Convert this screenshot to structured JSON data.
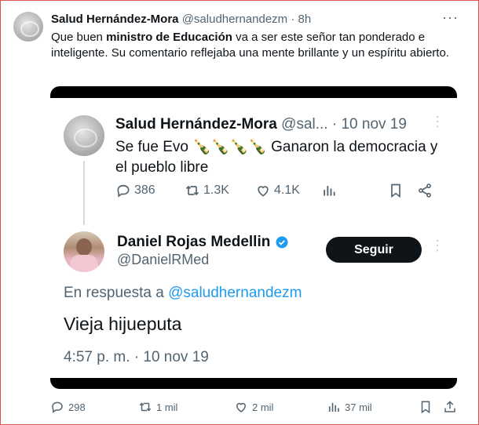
{
  "tweet": {
    "author_name": "Salud Hernández-Mora",
    "author_handle": "@saludhernandezm",
    "separator": "·",
    "time": "8h",
    "more": "···",
    "text_before": "Que buen ",
    "text_bold": "ministro de Educación",
    "text_after": " va a ser este señor tan ponderado e inteligente. Su comentario reflejaba una mente brillante y un espíritu abierto.",
    "stats": {
      "replies": "298",
      "retweets": "1 mil",
      "likes": "2 mil",
      "views": "37 mil"
    }
  },
  "screenshot": {
    "quoted": {
      "author_name": "Salud Hernández-Mora",
      "author_handle": "@sal...",
      "date": "· 10 nov 19",
      "text": "Se fue Evo 🍾🍾🍾🍾 Ganaron la democracia y el pueblo libre",
      "stats": {
        "replies": "386",
        "retweets": "1.3K",
        "likes": "4.1K"
      },
      "more": "⋮"
    },
    "reply": {
      "author_name": "Daniel Rojas Medellin",
      "author_handle": "@DanielRMed",
      "follow_label": "Seguir",
      "more": "⋮",
      "reply_prefix": "En respuesta a ",
      "reply_handle": "@saludhernandezm",
      "text": "Vieja hijueputa",
      "timestamp": "4:57 p. m. · 10 nov 19"
    }
  },
  "colors": {
    "accent": "#1d9bf0",
    "text": "#0f1419",
    "muted": "#536471",
    "frame": "#d9534f"
  }
}
